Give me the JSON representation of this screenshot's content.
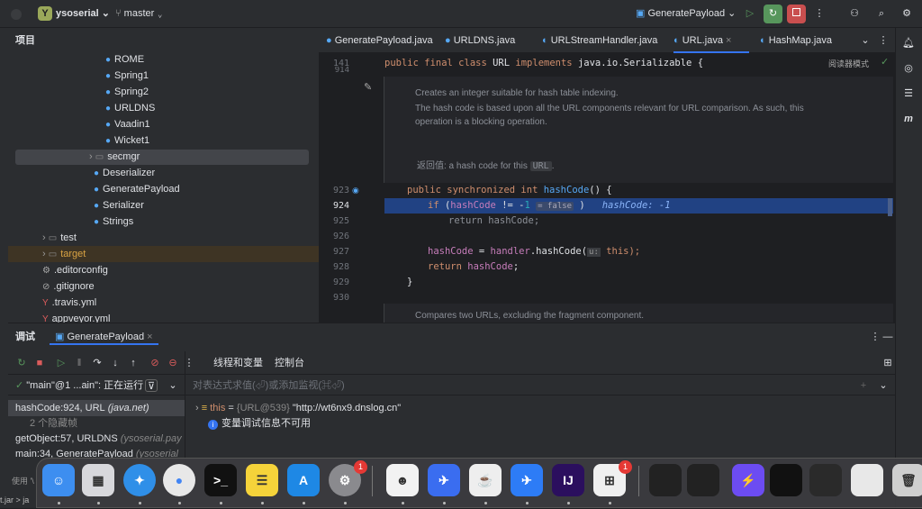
{
  "titlebar": {
    "project_icon": "Y",
    "project": "ysoserial",
    "branch": "master",
    "run_config": "GeneratePayload"
  },
  "project": {
    "title": "项目",
    "items": [
      {
        "label": "ROME",
        "icon": "class-icon"
      },
      {
        "label": "Spring1",
        "icon": "class-icon"
      },
      {
        "label": "Spring2",
        "icon": "class-icon"
      },
      {
        "label": "URLDNS",
        "icon": "class-icon"
      },
      {
        "label": "Vaadin1",
        "icon": "class-icon"
      },
      {
        "label": "Wicket1",
        "icon": "class-icon"
      },
      {
        "label": "secmgr",
        "icon": "folder-icon"
      },
      {
        "label": "Deserializer",
        "icon": "class-icon"
      },
      {
        "label": "GeneratePayload",
        "icon": "class-icon"
      },
      {
        "label": "Serializer",
        "icon": "class-icon"
      },
      {
        "label": "Strings",
        "icon": "class-icon"
      },
      {
        "label": "test",
        "icon": "folder-icon"
      },
      {
        "label": "target",
        "icon": "folder-icon"
      },
      {
        "label": ".editorconfig",
        "icon": "gear-icon"
      },
      {
        "label": ".gitignore",
        "icon": "file-icon"
      },
      {
        "label": ".travis.yml",
        "icon": "yaml-icon"
      },
      {
        "label": "appveyor.yml",
        "icon": "yaml-icon"
      }
    ]
  },
  "editor": {
    "tabs": [
      "GeneratePayload.java",
      "URLDNS.java",
      "URLStreamHandler.java",
      "URL.java",
      "HashMap.java"
    ],
    "reader_mode": "阅读器模式",
    "line141": "141",
    "line_partial": "914",
    "class_decl": {
      "k1": "public final class ",
      "name": "URL ",
      "k2": "implements ",
      "rest": "java.io.Serializable {"
    },
    "doc1": "Creates an integer suitable for hash table indexing.",
    "doc2": "The hash code is based upon all the URL components relevant for URL comparison. As such, this",
    "doc3": "operation is a blocking operation.",
    "doc_return_label": "返回值: a hash code for this",
    "doc_return_code": "URL",
    "doc_next": "Compares two URLs, excluding the fragment component.",
    "lines": [
      "923",
      "924",
      "925",
      "926",
      "927",
      "928",
      "929",
      "930"
    ],
    "c923": {
      "k": "public synchronized int ",
      "fn": "hashCode",
      "rest": "() {"
    },
    "c924": {
      "k": "if ",
      "p1": "(",
      "fld": "hashCode",
      "op": " != -",
      "num": "1",
      "hint": "= false",
      "p2": " )",
      "inline": "hashCode: -1"
    },
    "c925": "return hashCode;",
    "c927": {
      "fld": "hashCode",
      "a": " = ",
      "fld2": "handler",
      "b": ".hashCode(",
      "hint": "u:",
      "c": " this);"
    },
    "c928": {
      "k": "return ",
      "fld": "hashCode",
      "e": ";"
    },
    "c929": "}"
  },
  "debug": {
    "tab_label": "调试",
    "session": "GeneratePayload",
    "view_tabs": [
      "线程和变量",
      "控制台"
    ],
    "thread": "\"main\"@1 ...ain\": 正在运行",
    "frames": [
      {
        "name": "hashCode:924, URL",
        "extra": "(java.net)"
      },
      {
        "name": "2 个隐藏帧",
        "extra": ""
      },
      {
        "name": "getObject:57, URLDNS",
        "extra": "(ysoserial.pay"
      },
      {
        "name": "main:34, GeneratePayload",
        "extra": "(ysoserial"
      }
    ],
    "eval_placeholder": "对表达式求值(⏎)或添加监视(⌘⏎)",
    "var_name": "this",
    "var_eq": " = ",
    "var_type": "{URL@539} ",
    "var_val": "\"http://wt6nx9.dnslog.cn\"",
    "info": "变量调试信息不可用",
    "status_left": "使用 '\\",
    "status_left2": "t.jar > ja"
  },
  "dock": {
    "apps": [
      {
        "name": "finder",
        "glyph": "☺",
        "bg": "#3d8ef0"
      },
      {
        "name": "launchpad",
        "glyph": "▦",
        "bg": "#d8d8dc"
      },
      {
        "name": "safari",
        "glyph": "✦",
        "bg": "#2f8fe8"
      },
      {
        "name": "chrome",
        "glyph": "●",
        "bg": "#e8e8e8"
      },
      {
        "name": "terminal",
        "glyph": ">_",
        "bg": "#111"
      },
      {
        "name": "notes",
        "glyph": "☰",
        "bg": "#f5d33a"
      },
      {
        "name": "app-store",
        "glyph": "A",
        "bg": "#1e88e5"
      },
      {
        "name": "system-settings",
        "glyph": "⚙",
        "bg": "#8a8a8e"
      },
      {
        "name": "qq",
        "glyph": "☻",
        "bg": "#f2f2f2"
      },
      {
        "name": "feishu",
        "glyph": "✈",
        "bg": "#3a6df0"
      },
      {
        "name": "java",
        "glyph": "☕",
        "bg": "#eee"
      },
      {
        "name": "lark",
        "glyph": "✈",
        "bg": "#2d7cf6"
      },
      {
        "name": "intellij",
        "glyph": "IJ",
        "bg": "#2b0f5e"
      },
      {
        "name": "microsoft",
        "glyph": "⊞",
        "bg": "#f0f0f0"
      },
      {
        "name": "window-1",
        "glyph": "",
        "bg": "#222"
      },
      {
        "name": "window-2",
        "glyph": "",
        "bg": "#222"
      },
      {
        "name": "burp",
        "glyph": "⚡",
        "bg": "#6c4cf2"
      },
      {
        "name": "window-3",
        "glyph": "",
        "bg": "#111"
      },
      {
        "name": "window-4",
        "glyph": "",
        "bg": "#2a2a2a"
      },
      {
        "name": "window-5",
        "glyph": "",
        "bg": "#e8e8e8"
      },
      {
        "name": "trash",
        "glyph": "🗑",
        "bg": "#cfcfcf"
      }
    ],
    "badge_settings": "1",
    "badge_microsoft": "1"
  },
  "colors": {
    "accent": "#3574f0",
    "selection": "#214283"
  }
}
